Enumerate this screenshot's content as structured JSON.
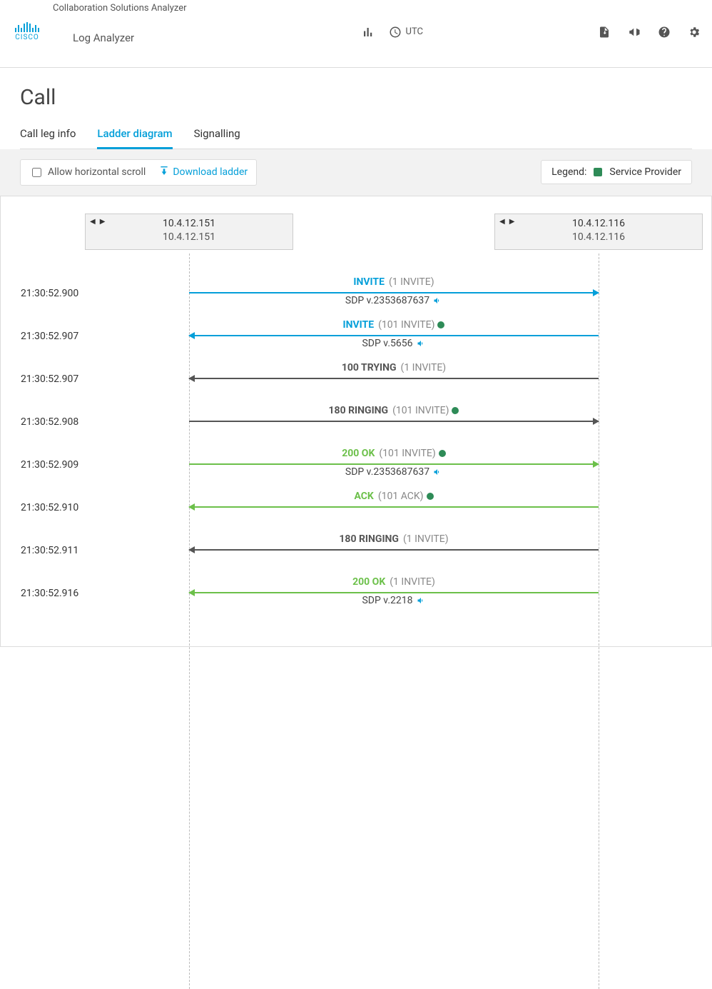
{
  "header": {
    "logo_text": "CISCO",
    "suite": "Collaboration Solutions Analyzer",
    "page": "Log Analyzer",
    "tz_label": "UTC"
  },
  "page_title": "Call",
  "tabs": {
    "info": "Call leg info",
    "ladder": "Ladder diagram",
    "signalling": "Signalling"
  },
  "toolbar": {
    "allow_scroll": "Allow horizontal scroll",
    "download": "Download ladder",
    "legend_label": "Legend:",
    "legend_item": "Service Provider"
  },
  "nodes": {
    "a": {
      "top": "10.4.12.151",
      "sub": "10.4.12.151"
    },
    "b": {
      "top": "10.4.12.116",
      "sub": "10.4.12.116"
    }
  },
  "rows": [
    {
      "ts": "21:30:52.900",
      "dir": "right",
      "color": "blue",
      "method": "INVITE",
      "hint": "(1 INVITE)",
      "sub": "SDP v.2353687637",
      "dot": false,
      "speaker": true
    },
    {
      "ts": "21:30:52.907",
      "dir": "left",
      "color": "blue",
      "method": "INVITE",
      "hint": "(101 INVITE)",
      "sub": "SDP v.5656",
      "dot": true,
      "speaker": true
    },
    {
      "ts": "21:30:52.907",
      "dir": "left",
      "color": "dark",
      "method": "100 TRYING",
      "hint": "(1 INVITE)",
      "sub": "",
      "dot": false,
      "speaker": false
    },
    {
      "ts": "21:30:52.908",
      "dir": "right",
      "color": "dark",
      "method": "180 RINGING",
      "hint": "(101 INVITE)",
      "sub": "",
      "dot": true,
      "speaker": false
    },
    {
      "ts": "21:30:52.909",
      "dir": "right",
      "color": "green",
      "method": "200 OK",
      "hint": "(101 INVITE)",
      "sub": "SDP v.2353687637",
      "dot": true,
      "speaker": true
    },
    {
      "ts": "21:30:52.910",
      "dir": "left",
      "color": "green",
      "method": "ACK",
      "hint": "(101 ACK)",
      "sub": "",
      "dot": true,
      "speaker": false
    },
    {
      "ts": "21:30:52.911",
      "dir": "left",
      "color": "dark",
      "method": "180 RINGING",
      "hint": "(1 INVITE)",
      "sub": "",
      "dot": false,
      "speaker": false
    },
    {
      "ts": "21:30:52.916",
      "dir": "left",
      "color": "green",
      "method": "200 OK",
      "hint": "(1 INVITE)",
      "sub": "SDP v.2218",
      "dot": false,
      "speaker": true
    }
  ]
}
